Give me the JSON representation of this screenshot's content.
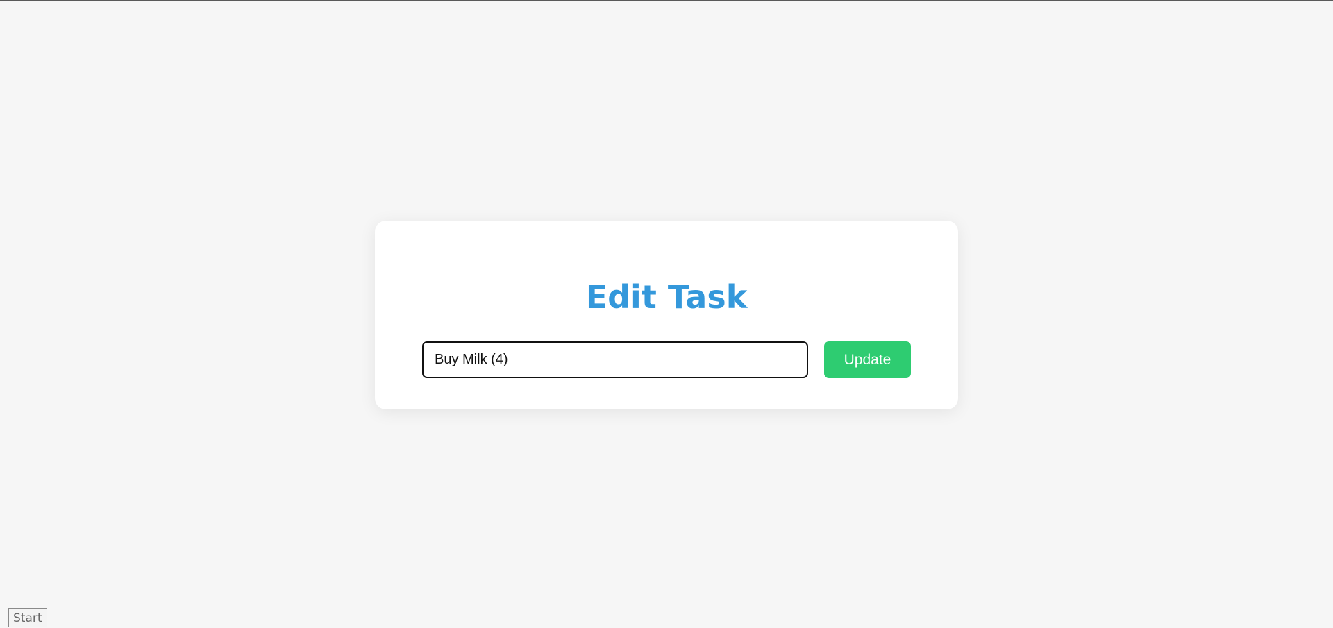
{
  "edit_form": {
    "title": "Edit Task",
    "task_value": "Buy Milk (4)",
    "update_label": "Update"
  },
  "taskbar": {
    "start_label": "Start"
  },
  "colors": {
    "title": "#3498db",
    "update_button": "#2ecc71",
    "page_background": "#f6f6f6",
    "card_background": "#ffffff"
  }
}
